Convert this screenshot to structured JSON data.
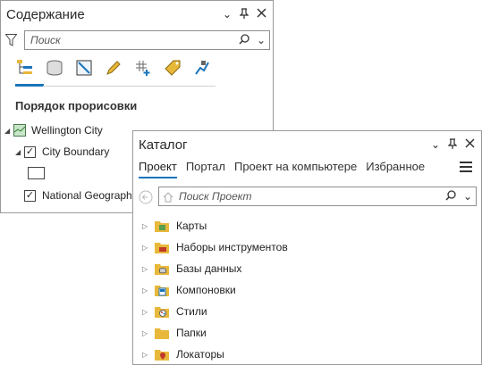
{
  "contents": {
    "title": "Содержание",
    "search_placeholder": "Поиск",
    "section": "Порядок прорисовки",
    "map_name": "Wellington City",
    "layer1": "City Boundary",
    "layer2": "National Geographi"
  },
  "catalog": {
    "title": "Каталог",
    "tabs": [
      "Проект",
      "Портал",
      "Проект на компьютере",
      "Избранное"
    ],
    "search_placeholder": "Поиск Проект",
    "items": [
      "Карты",
      "Наборы инструментов",
      "Базы данных",
      "Компоновки",
      "Стили",
      "Папки",
      "Локаторы"
    ]
  },
  "colors": {
    "accent": "#1b75bb",
    "folder": "#e8b83a"
  }
}
